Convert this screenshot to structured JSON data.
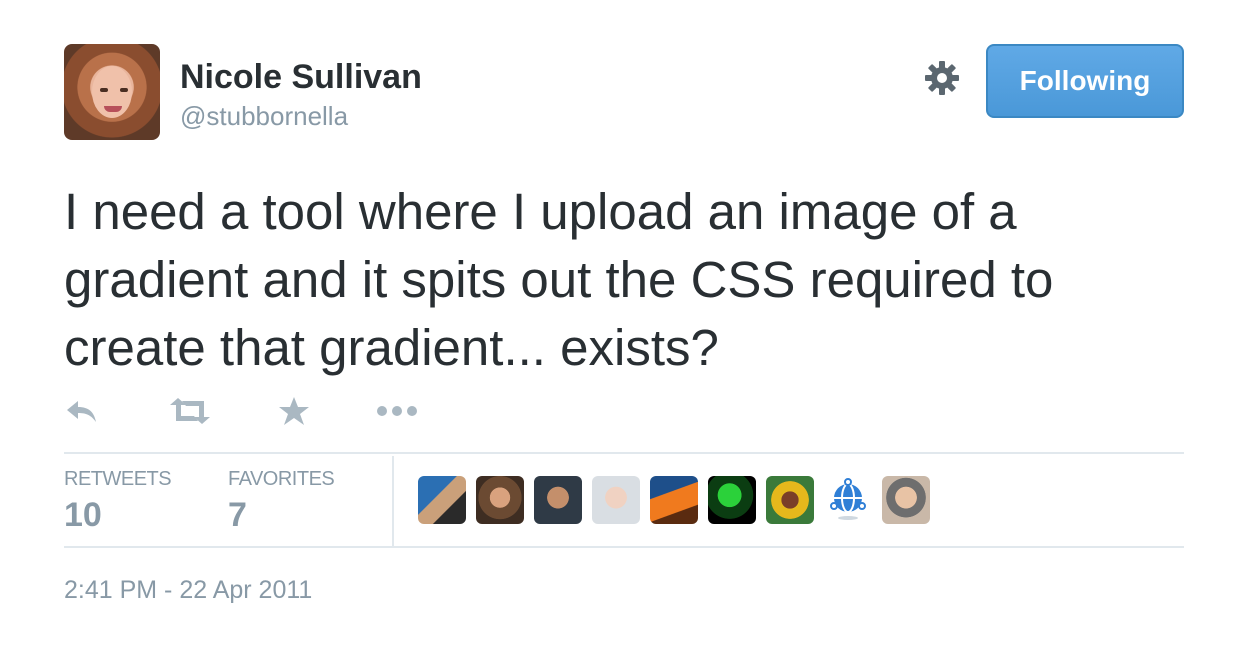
{
  "author": {
    "name": "Nicole Sullivan",
    "handle": "@stubbornella",
    "avatar_icon": "user-avatar-photo"
  },
  "follow_button": {
    "label": "Following",
    "color": "#55a1e3"
  },
  "settings": {
    "icon": "gear-icon"
  },
  "tweet": {
    "lines": [
      "I need a tool where I upload an image of a",
      "gradient and it spits out the CSS required to",
      "create that gradient... exists?"
    ]
  },
  "actions": [
    {
      "name": "reply",
      "icon": "reply-icon"
    },
    {
      "name": "retweet",
      "icon": "retweet-icon"
    },
    {
      "name": "favorite",
      "icon": "star-icon"
    },
    {
      "name": "more",
      "icon": "more-icon"
    }
  ],
  "stats": {
    "retweets_label": "RETWEETS",
    "retweets_value": "10",
    "favorites_label": "FAVORITES",
    "favorites_value": "7"
  },
  "favoriters": [
    {
      "icon": "avatar-photo"
    },
    {
      "icon": "avatar-photo"
    },
    {
      "icon": "avatar-photo"
    },
    {
      "icon": "avatar-photo"
    },
    {
      "icon": "avatar-photo"
    },
    {
      "icon": "avatar-photo"
    },
    {
      "icon": "avatar-photo"
    },
    {
      "icon": "avatar-globe"
    },
    {
      "icon": "avatar-photo"
    }
  ],
  "timestamp": "2:41 PM - 22 Apr 2011",
  "colors": {
    "text": "#292f33",
    "muted": "#8899a6",
    "divider": "#e1e8ed",
    "icon": "#aab8c2"
  }
}
